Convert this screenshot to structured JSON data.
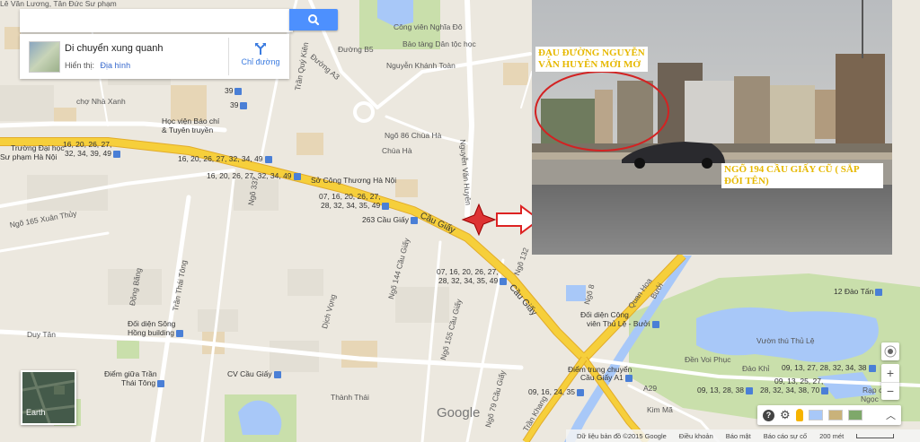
{
  "search": {
    "placeholder": "",
    "value": "",
    "button_icon": "search-icon"
  },
  "info_card": {
    "title": "Di chuyển xung quanh",
    "view_label": "Hiển thị:",
    "view_value": "Địa hình",
    "directions_label": "Chỉ đường"
  },
  "photo": {
    "caption_top_line1": "ĐẠU ĐƯỜNG NGUYỄN",
    "caption_top_line2": "VĂN HUYÊN MỚI MỞ",
    "caption_bottom_line1": "NGÕ 194 CẦU GIẤY CŨ ( SẮP",
    "caption_bottom_line2": "ĐỔI TÊN)"
  },
  "labels": {
    "top_left_1": "Lê Văn Lương, Tân Đức Sư phạm",
    "nha_xanh": "chợ Nhà Xanh",
    "hoc_vien": "Học viện Báo chí",
    "hoc_vien2": "& Tuyên truyền",
    "dh_su_pham": "Trường Đại học",
    "dh_su_pham2": "Sư phạm Hà Nội",
    "cong_vien_nghia_do": "Công viên Nghĩa Đô",
    "bao_tang_dan_toc": "Bảo tàng Dân tộc học",
    "duong_b5": "Đường B5",
    "duong_a3": "Đường A3",
    "nguyen_khanh_toan": "Nguyễn Khánh Toàn",
    "nguyen_van_huyen": "Nguyễn Văn Huyên",
    "tran_quy_kien": "Trần Quý Kiên",
    "ngo_86": "Ngõ 86 Chùa Hà",
    "chua_ha": "Chùa Hà",
    "so_cong_thuong": "Sở Công Thương Hà Nội",
    "cau_giay_263": "263 Cầu Giấy",
    "cau_giay": "Cầu Giấy",
    "cau_giay2": "Cầu Giấy",
    "xuan_thuy": "Ngõ 165 Xuân Thủy",
    "ngo_337": "Ngõ 337",
    "dong_bang": "Đông Băng",
    "tran_thai_tong": "Trần Thái Tông",
    "doi_dien_song_hong": "Đối diện Sông",
    "doi_dien_song_hong2": "Hồng building",
    "duy_tan": "Duy Tân",
    "diem_giua": "Điểm giữa Trần",
    "diem_giua2": "Thái Tông",
    "cv_cau_giay": "CV Cầu Giấy",
    "thanh_thai": "Thành Thái",
    "dich_vong": "Dịch Vọng",
    "ngo_144": "Ngõ 144 Cầu Giấy",
    "ngo_155": "Ngõ 155 Cầu Giấy",
    "ngo_79": "Ngõ 79 Cầu Giấy",
    "ngo_132": "Ngõ 132",
    "ngo_8": "Ngõ 8",
    "doi_dien_cong_vien": "Đối diện Công",
    "doi_dien_cong_vien2": "viên Thủ Lệ - Bưởi",
    "quan_hoa": "Quan Hoa",
    "buoi": "Bưởi",
    "diem_trung_chuyen": "Điểm trung chuyển",
    "diem_trung_chuyen2": "Cầu Giấy A1",
    "a29": "A29",
    "kim_ma": "Kim Mã",
    "tran_khang": "Trần Khang",
    "vuon_thu": "Vườn thú Thủ Lệ",
    "den_voi_phuc": "Đền Voi Phục",
    "dao_khi": "Đảo Khỉ",
    "dao_tan": "12 Đào Tấn",
    "rap_chieu": "Rạp chiếu",
    "ngoc": "Ngọc",
    "google": "Google"
  },
  "bus_routes": {
    "r1": "16, 20, 26, 27,",
    "r1b": "32, 34, 39, 49",
    "r2": "16, 20, 26, 27, 32, 34, 49",
    "r3": "16, 20, 26, 27, 32, 34, 49",
    "r4": "07, 16, 20, 26, 27,",
    "r4b": "28, 32, 34, 35, 49",
    "r5": "07, 16, 20, 26, 27,",
    "r5b": "28, 32, 34, 35, 49",
    "r6": "09, 16, 24, 35",
    "r7": "09, 13, 27, 28, 32, 34, 38",
    "r8": "09, 13, 25, 27,",
    "r8b": "28, 32, 34, 38, 70",
    "r9": "09, 13, 28, 38",
    "n39a": "39",
    "n39b": "39"
  },
  "earth": {
    "label": "Earth"
  },
  "footer": {
    "data": "Dữ liệu bản đồ ©2015 Google",
    "terms": "Điều khoản",
    "report": "Báo mật",
    "send": "Báo cáo sự cố",
    "scale": "200 mét"
  },
  "colors": {
    "highway": "#f6cf3b",
    "highway_edge": "#e2ac2a",
    "water": "#a8c8f8",
    "park": "#c9dfab",
    "accent": "#4d90fe"
  }
}
